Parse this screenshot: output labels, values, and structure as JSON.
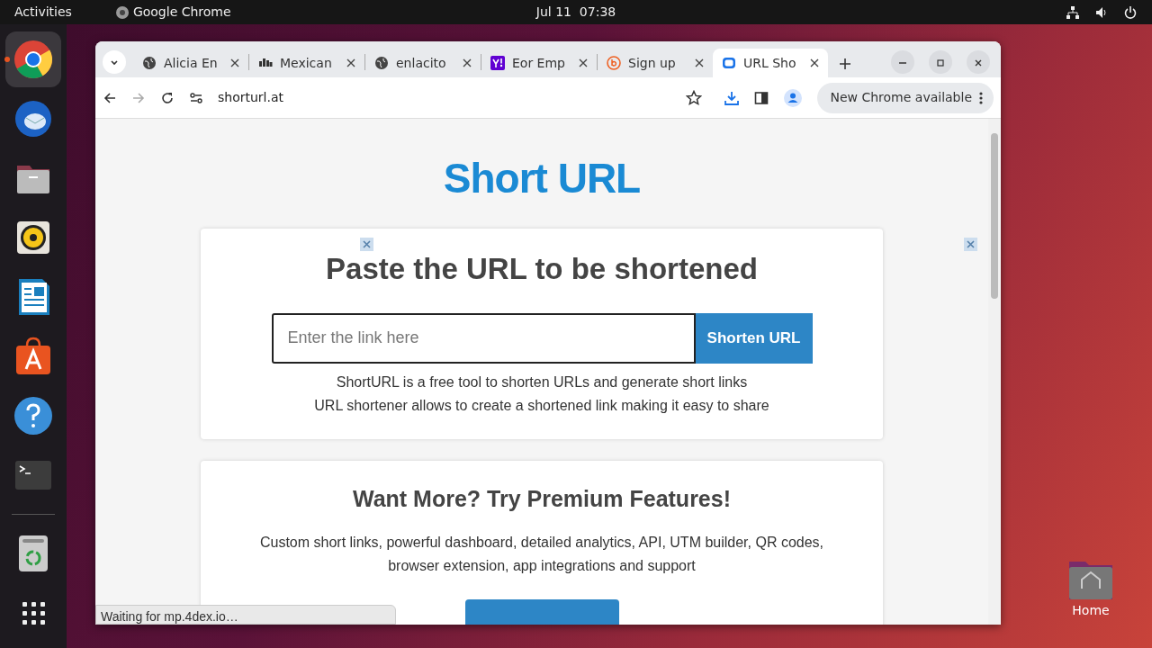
{
  "top_bar": {
    "activities": "Activities",
    "app": "Google Chrome",
    "clock": "Jul 11  07:38"
  },
  "dock": [
    {
      "kind": "chrome",
      "running": true
    },
    {
      "kind": "mail",
      "running": false
    },
    {
      "kind": "files",
      "running": false
    },
    {
      "kind": "audio",
      "running": false
    },
    {
      "kind": "writer",
      "running": false
    },
    {
      "kind": "store",
      "running": false
    },
    {
      "kind": "help",
      "running": false
    },
    {
      "kind": "terminal",
      "running": false
    },
    {
      "kind": "trash",
      "running": false
    },
    {
      "kind": "apps",
      "running": false
    }
  ],
  "browser": {
    "tabs": [
      {
        "title": "Alicia En",
        "kind": "globe",
        "selected": false
      },
      {
        "title": "Mexican",
        "kind": "bars",
        "selected": false
      },
      {
        "title": "enlacito",
        "kind": "globe",
        "selected": false
      },
      {
        "title": "Eor Emp",
        "kind": "yahoo",
        "selected": false
      },
      {
        "title": "Sign up",
        "kind": "bitly",
        "selected": false
      },
      {
        "title": "URL Sho",
        "kind": "shorturl",
        "selected": true
      }
    ],
    "address": "shorturl.at",
    "update_button": "New Chrome available",
    "status": "Waiting for mp.4dex.io…"
  },
  "page": {
    "heading": "Short URL",
    "card_title": "Paste the URL to be shortened",
    "input_placeholder": "Enter the link here",
    "shorten_button": "Shorten URL",
    "lines": [
      "ShortURL is a free tool to shorten URLs and generate short links",
      "URL shortener allows to create a shortened link making it easy to share"
    ],
    "premium_title": "Want More? Try Premium Features!",
    "premium_lines": [
      "Custom short links, powerful dashboard, detailed analytics, API, UTM builder, QR codes,",
      "browser extension, app integrations and support"
    ]
  },
  "desktop_icons": [
    {
      "label": "Home"
    }
  ]
}
